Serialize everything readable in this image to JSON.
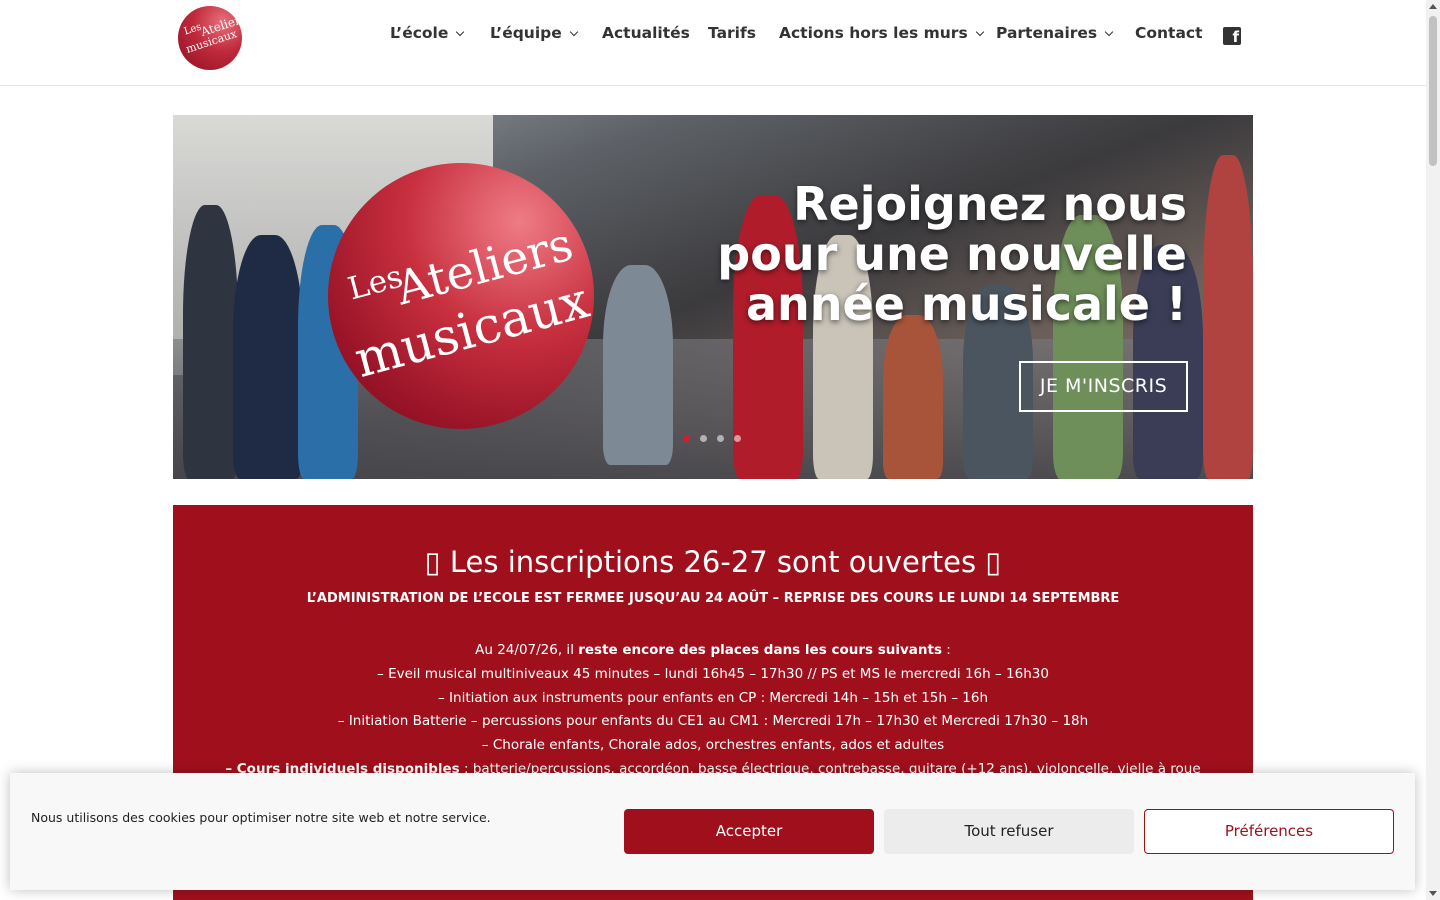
{
  "header": {
    "logo_line1": "Les",
    "logo_line2": "Ateliers",
    "logo_line3": "musicaux",
    "nav": [
      {
        "label": "L’école",
        "dropdown": true
      },
      {
        "label": "L’équipe",
        "dropdown": true
      },
      {
        "label": "Actualités",
        "dropdown": false
      },
      {
        "label": "Tarifs",
        "dropdown": false
      },
      {
        "label": "Actions hors les murs",
        "dropdown": true
      },
      {
        "label": "Partenaires",
        "dropdown": true
      },
      {
        "label": "Contact",
        "dropdown": false
      }
    ],
    "social_icon": "facebook-icon"
  },
  "hero": {
    "logo_small": "Les",
    "logo_big": "Ateliers",
    "logo_bottom": "musicaux",
    "title_line1": "Rejoignez nous",
    "title_line2": "pour une nouvelle",
    "title_line3": "année musicale !",
    "cta_label": "JE M'INSCRIS",
    "slides_count": 4,
    "active_slide": 1
  },
  "info": {
    "title": "Les inscriptions 26-27 sont ouvertes",
    "subtitle": "L’ADMINISTRATION DE L’ECOLE EST FERMEE JUSQU’AU 24 AOÛT – REPRISE DES COURS LE LUNDI 14 SEPTEMBRE",
    "intro_prefix": "Au 24/07/26, il ",
    "intro_bold": "reste encore des places dans les cours suivants",
    "intro_suffix": " :",
    "lines": [
      "– Eveil musical multiniveaux 45 minutes – lundi 16h45 – 17h30 // PS et MS le mercredi 16h – 16h30",
      "– Initiation aux instruments pour enfants en CP : Mercredi 14h – 15h et 15h – 16h",
      "– Initiation Batterie – percussions pour enfants du CE1 au CM1 : Mercredi 17h – 17h30 et Mercredi 17h30 – 18h",
      "– Chorale enfants, Chorale ados, orchestres enfants, ados et adultes"
    ],
    "last_bold": "– Cours individuels disponibles",
    "last_rest": " : batterie/percussions, accordéon, basse électrique, contrebasse, guitare (+12 ans), violoncelle, vielle à roue"
  },
  "cookie": {
    "text": "Nous utilisons des cookies pour optimiser notre site web et notre service.",
    "accept": "Accepter",
    "refuse": "Tout refuser",
    "prefs": "Préférences"
  },
  "colors": {
    "brand_red": "#a0101c",
    "nav_text": "#333333"
  }
}
